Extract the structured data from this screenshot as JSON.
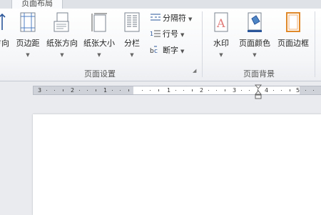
{
  "tabs": {
    "active": "页面布局"
  },
  "groups": {
    "page_setup": {
      "label": "页面设置",
      "buttons": {
        "orientation": "方向",
        "margins": "页边距",
        "orientation2": "纸张方向",
        "size": "纸张大小",
        "columns": "分栏"
      },
      "small": {
        "breaks": "分隔符",
        "line_numbers": "行号",
        "hyphenation": "断字"
      }
    },
    "page_background": {
      "label": "页面背景",
      "buttons": {
        "watermark": "水印",
        "page_color": "页面颜色",
        "page_borders": "页面边框"
      }
    }
  },
  "ruler": {
    "numbers": [
      "3",
      "2",
      "1",
      "1",
      "2",
      "3",
      "4",
      "5"
    ]
  },
  "colors": {
    "accent": "#2b579a",
    "ruler_margin": "#cfd3d9"
  }
}
